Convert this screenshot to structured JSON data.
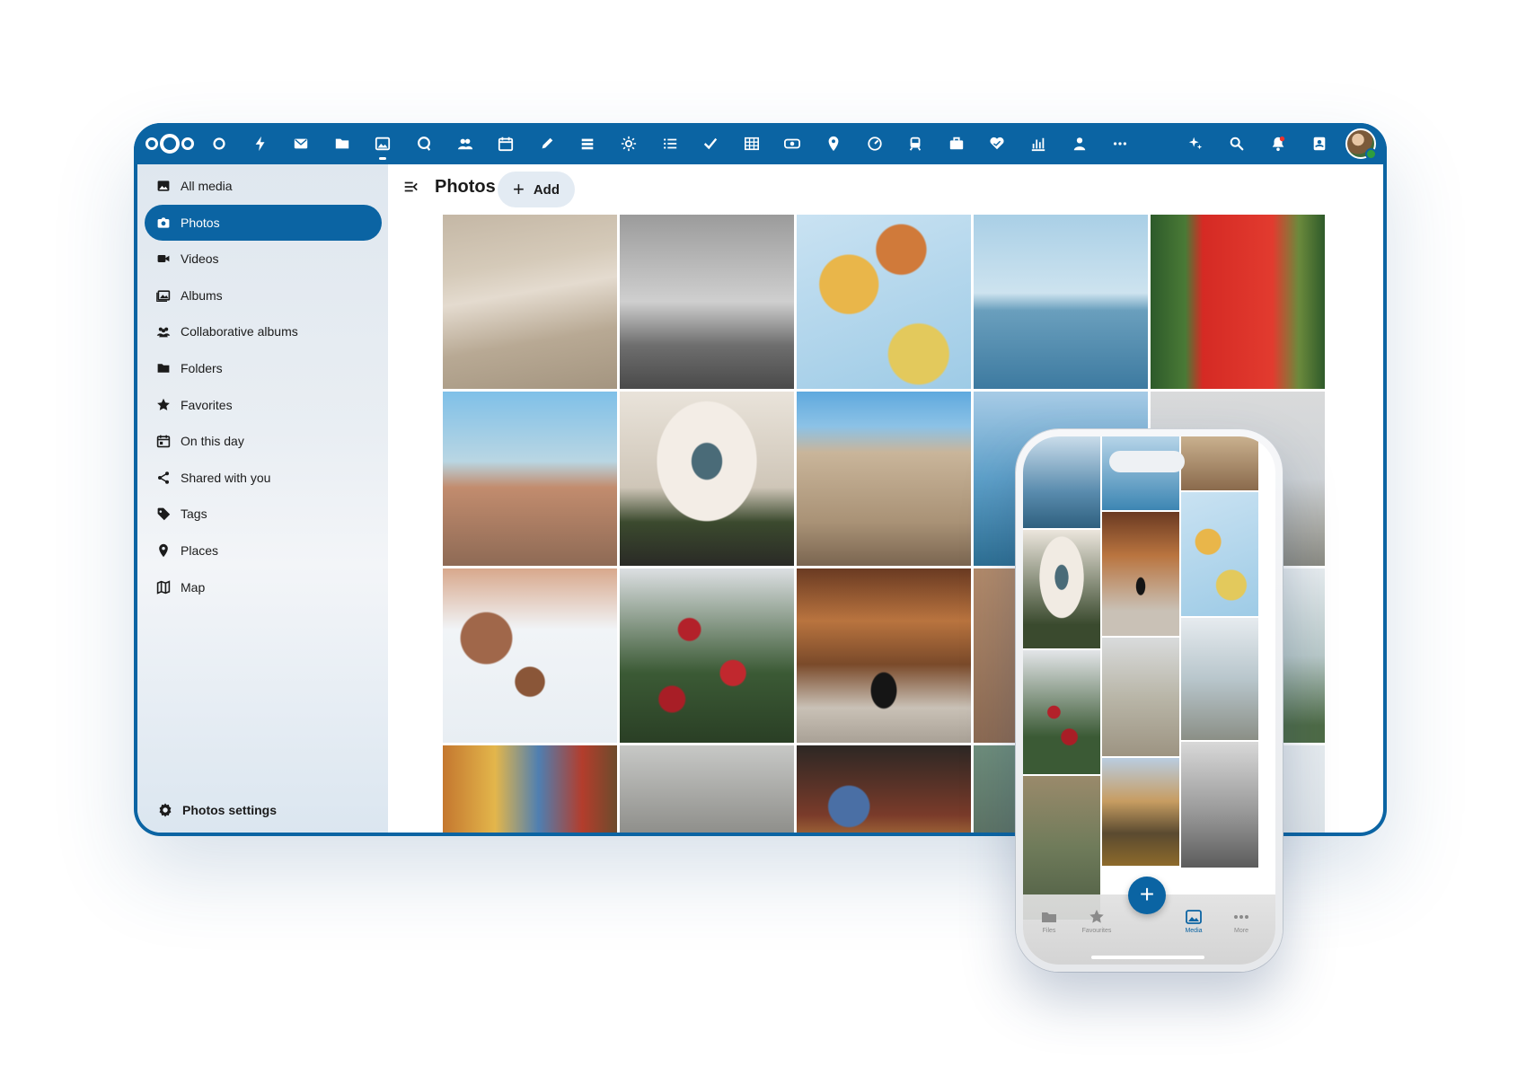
{
  "colors": {
    "brand": "#0b64a3",
    "accent_light": "#e3ebf3"
  },
  "topbar": {
    "logo": "nextcloud-logo",
    "apps": [
      {
        "icon": "dashboard-icon"
      },
      {
        "icon": "activity-icon"
      },
      {
        "icon": "mail-icon"
      },
      {
        "icon": "files-icon"
      },
      {
        "icon": "photos-icon",
        "active": true
      },
      {
        "icon": "talk-icon"
      },
      {
        "icon": "contacts-icon"
      },
      {
        "icon": "calendar-icon"
      },
      {
        "icon": "notes-icon"
      },
      {
        "icon": "deck-icon"
      },
      {
        "icon": "sun-icon"
      },
      {
        "icon": "tasks-icon"
      },
      {
        "icon": "checkmark-icon"
      },
      {
        "icon": "tables-icon"
      },
      {
        "icon": "cospend-icon"
      },
      {
        "icon": "maps-icon"
      },
      {
        "icon": "gauge-icon"
      },
      {
        "icon": "train-icon"
      },
      {
        "icon": "briefcase-icon"
      },
      {
        "icon": "heart-icon"
      },
      {
        "icon": "analytics-icon"
      },
      {
        "icon": "user-icon"
      },
      {
        "icon": "more-icon"
      }
    ],
    "right_icons": [
      "assistant-icon",
      "search-icon",
      "notifications-icon",
      "contacts-menu-icon"
    ]
  },
  "sidebar": {
    "items": [
      {
        "label": "All media",
        "icon": "image-icon"
      },
      {
        "label": "Photos",
        "icon": "camera-icon",
        "active": true
      },
      {
        "label": "Videos",
        "icon": "video-icon"
      },
      {
        "label": "Albums",
        "icon": "albums-icon"
      },
      {
        "label": "Collaborative albums",
        "icon": "people-icon"
      },
      {
        "label": "Folders",
        "icon": "folder-icon"
      },
      {
        "label": "Favorites",
        "icon": "star-icon"
      },
      {
        "label": "On this day",
        "icon": "calendar-day-icon"
      },
      {
        "label": "Shared with you",
        "icon": "share-icon"
      },
      {
        "label": "Tags",
        "icon": "tag-icon"
      },
      {
        "label": "Places",
        "icon": "map-marker-icon"
      },
      {
        "label": "Map",
        "icon": "map-icon"
      }
    ],
    "settings_label": "Photos settings"
  },
  "main": {
    "title": "Photos",
    "add_label": "Add"
  },
  "phone": {
    "tabs": [
      {
        "label": "Files",
        "icon": "folder-icon"
      },
      {
        "label": "Favourites",
        "icon": "star-icon"
      },
      {
        "label": "Media",
        "icon": "image-icon",
        "active": true
      },
      {
        "label": "More",
        "icon": "more-icon"
      }
    ],
    "fab_label": "+"
  }
}
